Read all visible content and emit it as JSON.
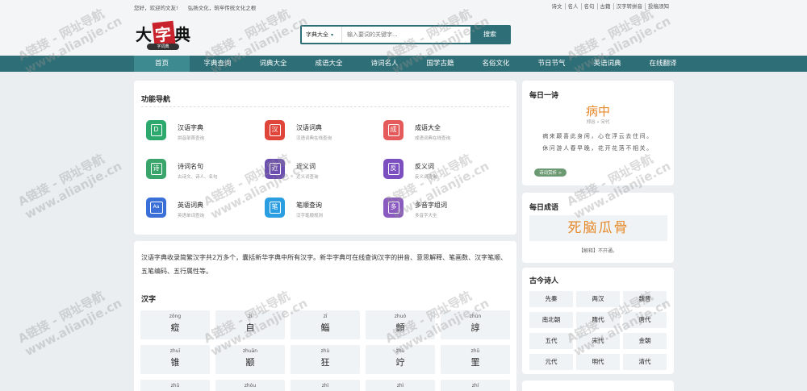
{
  "topbar": {
    "welcome": "您好，欢迎的文友!",
    "slogan": "弘扬文化，筑牢传统文化之根",
    "links": [
      "诗文",
      "名人",
      "名句",
      "古籍",
      "汉字转拼音",
      "投稿须知"
    ]
  },
  "logo": {
    "text_a": "大",
    "text_b": "字",
    "text_c": "典",
    "sub": "字词典"
  },
  "search": {
    "select": "字典大全",
    "placeholder": "输入要词的关键字...",
    "button": "搜索"
  },
  "nav": [
    "首页",
    "字典查询",
    "词典大全",
    "成语大全",
    "诗词名人",
    "国学古籍",
    "名俗文化",
    "节日节气",
    "英语词典",
    "在线翻译"
  ],
  "func_nav": {
    "title": "功能导航",
    "items": [
      {
        "name": "汉语字典",
        "desc": "拼音部首查询",
        "icon": "D",
        "color": "#2ea96e"
      },
      {
        "name": "汉语词典",
        "desc": "汉语词典在线查询",
        "icon": "汉",
        "color": "#e0453a"
      },
      {
        "name": "成语大全",
        "desc": "成语词典在线查询",
        "icon": "成",
        "color": "#e55a5a"
      },
      {
        "name": "诗词名句",
        "desc": "古诗文、诗人、名句",
        "icon": "诗",
        "color": "#3aa56a"
      },
      {
        "name": "近义词",
        "desc": "近义词查询",
        "icon": "近",
        "color": "#6c4db0"
      },
      {
        "name": "反义词",
        "desc": "反义词查询",
        "icon": "反",
        "color": "#7b4fc0"
      },
      {
        "name": "英语词典",
        "desc": "英语单词查询",
        "icon": "Aa",
        "color": "#3a6fd8"
      },
      {
        "name": "笔顺查询",
        "desc": "汉字笔顺规则",
        "icon": "笔",
        "color": "#2a9ee0"
      },
      {
        "name": "多音字组词",
        "desc": "多音字大全",
        "icon": "多",
        "color": "#8a5ac0"
      }
    ]
  },
  "intro": {
    "text": "汉语字典收录简繁汉字共2万多个，囊括新华字典中所有汉字。新华字典可在线查询汉字的拼音、意思解释、笔画数、汉字笔顺、五笔编码、五行属性等。",
    "chars_title": "汉字",
    "chars": [
      {
        "py": "zōng",
        "hz": "瘲"
      },
      {
        "py": "zì",
        "hz": "自"
      },
      {
        "py": "zī",
        "hz": "鲻"
      },
      {
        "py": "zhuó",
        "hz": "顫"
      },
      {
        "py": "zhūn",
        "hz": "諄"
      },
      {
        "py": "zhuī",
        "hz": "锥"
      },
      {
        "py": "zhuān",
        "hz": "颛"
      },
      {
        "py": "zhù",
        "hz": "狂"
      },
      {
        "py": "zhù",
        "hz": "竚"
      },
      {
        "py": "zhǔ",
        "hz": "罜"
      },
      {
        "py": "zhū",
        "hz": ""
      },
      {
        "py": "zhòu",
        "hz": ""
      },
      {
        "py": "zhì",
        "hz": ""
      },
      {
        "py": "zhì",
        "hz": ""
      },
      {
        "py": "zhí",
        "hz": ""
      }
    ]
  },
  "poem": {
    "title": "每日一诗",
    "poem_title": "病中",
    "author": "郑谷 • 宋代",
    "lines": [
      "病来颠喜此身闲，心在浮云去住间。",
      "休问游人春早晚，花开花落不相关。"
    ],
    "more": "诗词赏析 >"
  },
  "idiom": {
    "title": "每日成语",
    "word": "死脑瓜骨",
    "explain": "【解释】不开通。"
  },
  "poets": {
    "title": "古今诗人",
    "eras": [
      "先秦",
      "两汉",
      "魏晋",
      "南北朝",
      "隋代",
      "唐代",
      "五代",
      "宋代",
      "金朝",
      "元代",
      "明代",
      "清代"
    ]
  },
  "watermark": {
    "line1": "A链接 - 网址导航",
    "line2": "www.alianjie.cn"
  }
}
